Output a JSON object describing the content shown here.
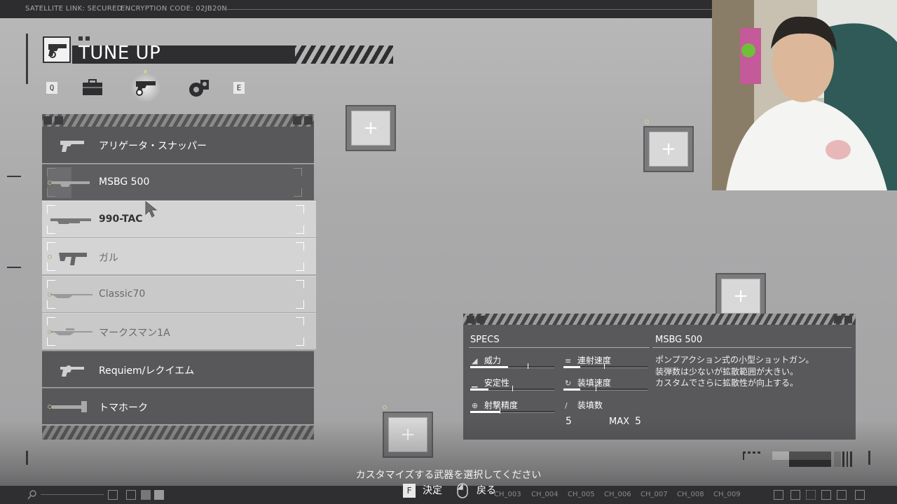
{
  "topbar": {
    "satellite": "SATELLITE LINK: SECURED",
    "encryption": "ENCRYPTION CODE: 02JB20N"
  },
  "header": {
    "title": "TUNE UP",
    "key_left": "Q",
    "key_right": "E"
  },
  "categories": [
    {
      "name": "briefcase-icon",
      "selected": false
    },
    {
      "name": "handgun-gear-icon",
      "selected": true
    },
    {
      "name": "gear-cluster-icon",
      "selected": false
    }
  ],
  "weapons": [
    {
      "label": "アリゲータ・スナッパー",
      "style": "dark",
      "icon": "pistol-icon"
    },
    {
      "label": "MSBG 500",
      "style": "dark",
      "icon": "shotgun-icon",
      "hover": true
    },
    {
      "label": "990-TAC",
      "style": "light",
      "icon": "pump-shotgun-icon",
      "active": true
    },
    {
      "label": "ガル",
      "style": "light",
      "icon": "smg-icon"
    },
    {
      "label": "Classic70",
      "style": "lightgray",
      "icon": "rifle-icon"
    },
    {
      "label": "マークスマン1A",
      "style": "lightgray",
      "icon": "marksman-rifle-icon"
    },
    {
      "label": "Requiem/レクイエム",
      "style": "dark",
      "icon": "revolver-icon"
    },
    {
      "label": "トマホーク",
      "style": "dark",
      "icon": "heavy-weapon-icon"
    }
  ],
  "slots": {
    "plus": "+"
  },
  "specs": {
    "heading": "SPECS",
    "weapon_name": "MSBG 500",
    "stats": [
      {
        "label": "威力",
        "icon": "power-icon",
        "value": 0.45,
        "marker": 0.68
      },
      {
        "label": "連射速度",
        "icon": "fire-rate-icon",
        "value": 0.2,
        "marker": 0.48
      },
      {
        "label": "安定性",
        "icon": "stability-icon",
        "value": 0.22,
        "marker": 0.5
      },
      {
        "label": "装填速度",
        "icon": "reload-speed-icon",
        "value": 0.2,
        "marker": 0.38
      },
      {
        "label": "射撃精度",
        "icon": "accuracy-icon",
        "value": 0.35,
        "marker": 0.35
      },
      {
        "label": "装填数",
        "icon": "capacity-icon"
      }
    ],
    "ammo_current": "5",
    "ammo_max_label": "MAX",
    "ammo_max": "5",
    "description": "ポンプアクション式の小型ショットガン。\n装弾数は少ないが拡散範囲が大きい。\nカスタムでさらに拡散性が向上する。"
  },
  "footer": {
    "instruction": "カスタマイズする武器を選択してください",
    "confirm_key": "F",
    "confirm_label": "決定",
    "back_label": "戻る",
    "channels": [
      "CH_003",
      "CH_004",
      "CH_005",
      "CH_006",
      "CH_007",
      "CH_008",
      "CH_009"
    ]
  }
}
